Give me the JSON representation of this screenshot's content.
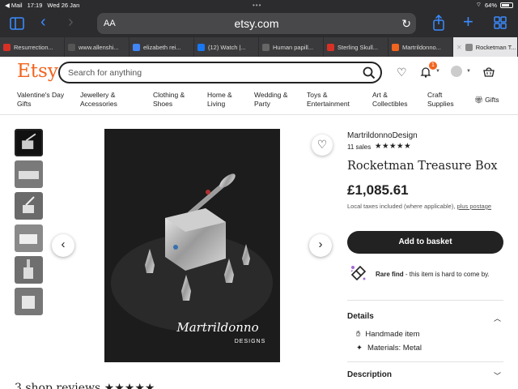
{
  "status_bar": {
    "back_app": "◀ Mail",
    "time": "17:19",
    "date": "Wed 26 Jan",
    "battery": "64%"
  },
  "browser": {
    "text_size": "AA",
    "url": "etsy.com",
    "tabs": [
      {
        "label": "Resurrection...",
        "color": "#d93025"
      },
      {
        "label": "www.allenshi...",
        "color": "#555555"
      },
      {
        "label": "elizabeth rei...",
        "color": "#4285f4"
      },
      {
        "label": "(12) Watch |...",
        "color": "#1877f2"
      },
      {
        "label": "Human papill...",
        "color": "#666666"
      },
      {
        "label": "Sterling Skull...",
        "color": "#d93025"
      },
      {
        "label": "Martrildonno...",
        "color": "#f1641e"
      },
      {
        "label": "Rocketman T...",
        "color": "#888888",
        "active": true
      }
    ]
  },
  "header": {
    "logo": "Etsy",
    "search_placeholder": "Search for anything",
    "notification_count": "1"
  },
  "categories": [
    "Valentine's Day Gifts",
    "Jewellery & Accessories",
    "Clothing & Shoes",
    "Home & Living",
    "Wedding & Party",
    "Toys & Entertainment",
    "Art & Collectibles",
    "Craft Supplies",
    "Gifts"
  ],
  "product": {
    "shop_name": "MartrildonnoDesign",
    "sales": "11 sales",
    "rating_stars": "★★★★★",
    "title": "Rocketman Treasure Box",
    "price": "£1,085.61",
    "tax_note": "Local taxes included (where applicable),",
    "tax_link": "plus postage",
    "add_to_basket": "Add to basket",
    "rare_find_title": "Rare find",
    "rare_find_text": " - this item is hard to come by.",
    "details_heading": "Details",
    "details": [
      "Handmade item",
      "Materials: Metal"
    ],
    "description_heading": "Description",
    "signature_line1": "Martrildonno",
    "signature_line2": "DESIGNS"
  },
  "reviews": {
    "heading": "3 shop reviews",
    "stars": "★★★★★"
  },
  "colors": {
    "etsy_orange": "#f1641e",
    "safari_blue": "#3a8bff",
    "chrome_dark": "#2c2c2e"
  }
}
